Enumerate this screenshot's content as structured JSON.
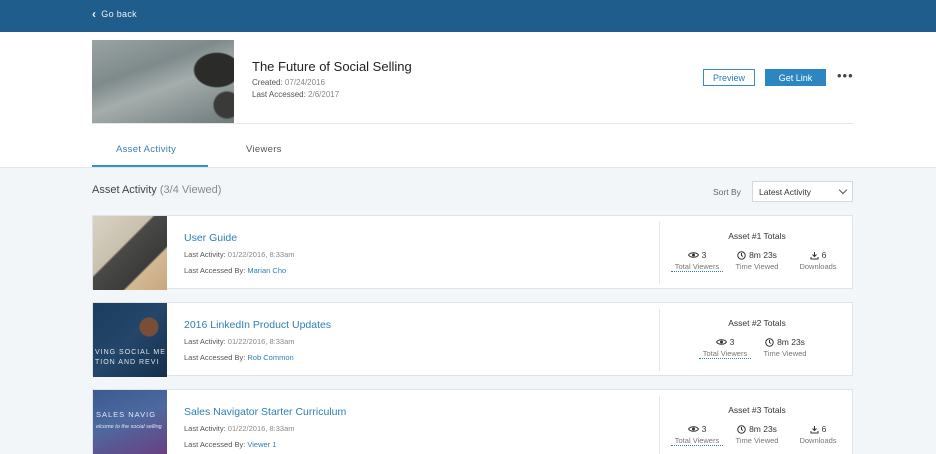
{
  "nav": {
    "back_label": "Go back"
  },
  "asset": {
    "title": "The Future of Social Selling",
    "created_label": "Created:",
    "created_value": "07/24/2016",
    "accessed_label": "Last Accessed:",
    "accessed_value": "2/6/2017",
    "preview_label": "Preview",
    "getlink_label": "Get Link",
    "more_label": "•••"
  },
  "tabs": [
    {
      "label": "Asset Activity",
      "active": true
    },
    {
      "label": "Viewers",
      "active": false
    }
  ],
  "section": {
    "title": "Asset Activity",
    "count": "(3/4 Viewed)",
    "sort_label": "Sort By",
    "sort_value": "Latest Activity"
  },
  "cards": [
    {
      "title": "User Guide",
      "activity_label": "Last Activity:",
      "activity_value": "01/22/2016, 8:33am",
      "accessed_by_label": "Last Accessed By:",
      "accessed_by_value": "Marian Cho",
      "totals_title": "Asset #1 Totals",
      "viewers": "3",
      "viewers_label": "Total Viewers",
      "time": "8m 23s",
      "time_label": "Time Viewed",
      "downloads": "6",
      "downloads_label": "Downloads"
    },
    {
      "title": "2016 LinkedIn Product Updates",
      "activity_label": "Last Activity:",
      "activity_value": "01/22/2016, 8:33am",
      "accessed_by_label": "Last Accessed By:",
      "accessed_by_value": "Rob Common",
      "totals_title": "Asset #2 Totals",
      "viewers": "3",
      "viewers_label": "Total Viewers",
      "time": "8m 23s",
      "time_label": "Time Viewed",
      "thumb_text_1": "VING SOCIAL ME",
      "thumb_text_2": "TION AND REVI"
    },
    {
      "title": "Sales Navigator Starter Curriculum",
      "activity_label": "Last Activity:",
      "activity_value": "01/22/2016, 8:33am",
      "accessed_by_label": "Last Accessed By:",
      "accessed_by_value": "Viewer 1",
      "totals_title": "Asset #3 Totals",
      "viewers": "3",
      "viewers_label": "Total Viewers",
      "time": "8m 23s",
      "time_label": "Time Viewed",
      "downloads": "6",
      "downloads_label": "Downloads",
      "thumb_text_1": "SALES NAVIG",
      "thumb_text_2": "elcome to the social selling"
    }
  ],
  "colors": {
    "topbar": "#1f5d8c",
    "accent": "#2d86c2",
    "link": "#2e7fb7"
  },
  "icons": {
    "back": "chevron-left-icon",
    "viewers": "eye-icon",
    "time": "clock-icon",
    "downloads": "download-icon",
    "sort": "chevron-down-icon"
  }
}
